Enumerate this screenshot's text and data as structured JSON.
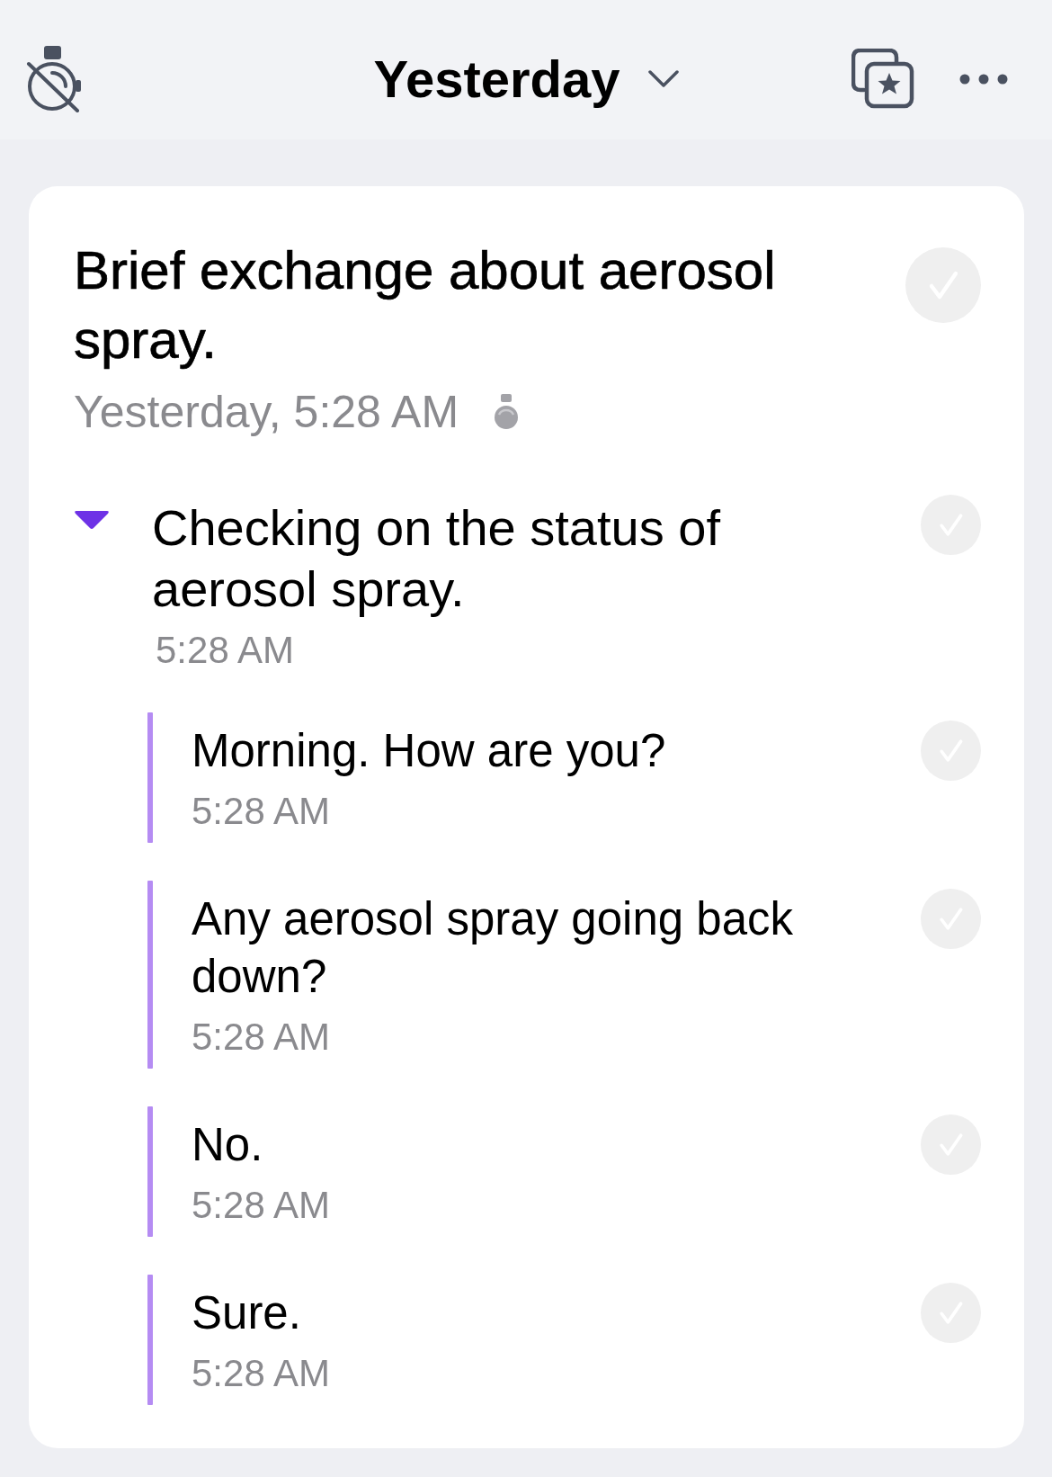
{
  "top_bar": {
    "title": "Yesterday"
  },
  "card": {
    "title": "Brief exchange about aerosol spray.",
    "timestamp": "Yesterday, 5:28 AM",
    "checked": false,
    "section": {
      "title": "Checking on the status of aerosol spray.",
      "time": "5:28 AM",
      "expanded": true,
      "checked": false,
      "messages": [
        {
          "text": "Morning. How are you?",
          "time": "5:28 AM",
          "checked": false
        },
        {
          "text": "Any aerosol spray going back down?",
          "time": "5:28 AM",
          "checked": false
        },
        {
          "text": "No.",
          "time": "5:28 AM",
          "checked": false
        },
        {
          "text": "Sure.",
          "time": "5:28 AM",
          "checked": false
        }
      ]
    }
  }
}
